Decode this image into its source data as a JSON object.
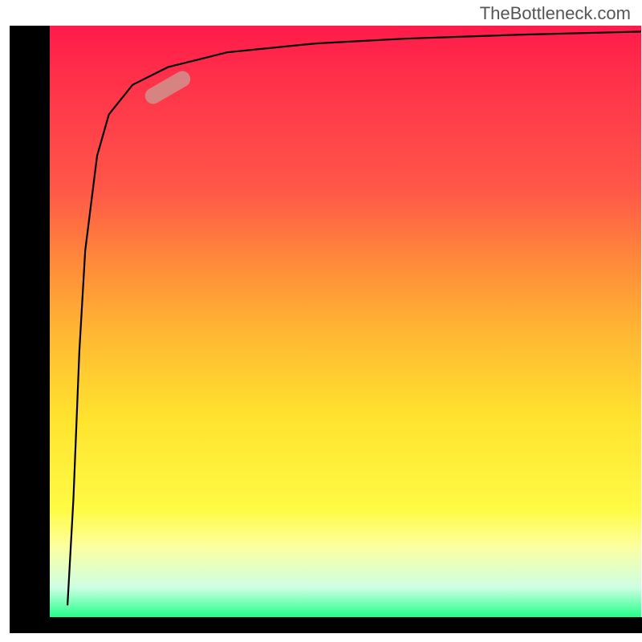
{
  "attribution": "TheBottleneck.com",
  "chart_data": {
    "type": "line",
    "title": "",
    "xlabel": "",
    "ylabel": "",
    "xlim": [
      0,
      100
    ],
    "ylim": [
      0,
      100
    ],
    "series": [
      {
        "name": "curve",
        "x": [
          3,
          4,
          5,
          6,
          8,
          10,
          14,
          20,
          30,
          45,
          60,
          80,
          100
        ],
        "y": [
          2,
          20,
          45,
          62,
          78,
          85,
          90,
          93,
          95.5,
          97,
          97.8,
          98.5,
          99
        ]
      }
    ],
    "highlight_segment": {
      "x_range": [
        16,
        24
      ],
      "y_range": [
        87,
        92
      ]
    },
    "background_gradient": {
      "stops": [
        {
          "pos": 0,
          "color": "#ff1a4a"
        },
        {
          "pos": 28,
          "color": "#ff5848"
        },
        {
          "pos": 52,
          "color": "#ffb733"
        },
        {
          "pos": 82,
          "color": "#fffb45"
        },
        {
          "pos": 100,
          "color": "#24ff8a"
        }
      ]
    }
  }
}
